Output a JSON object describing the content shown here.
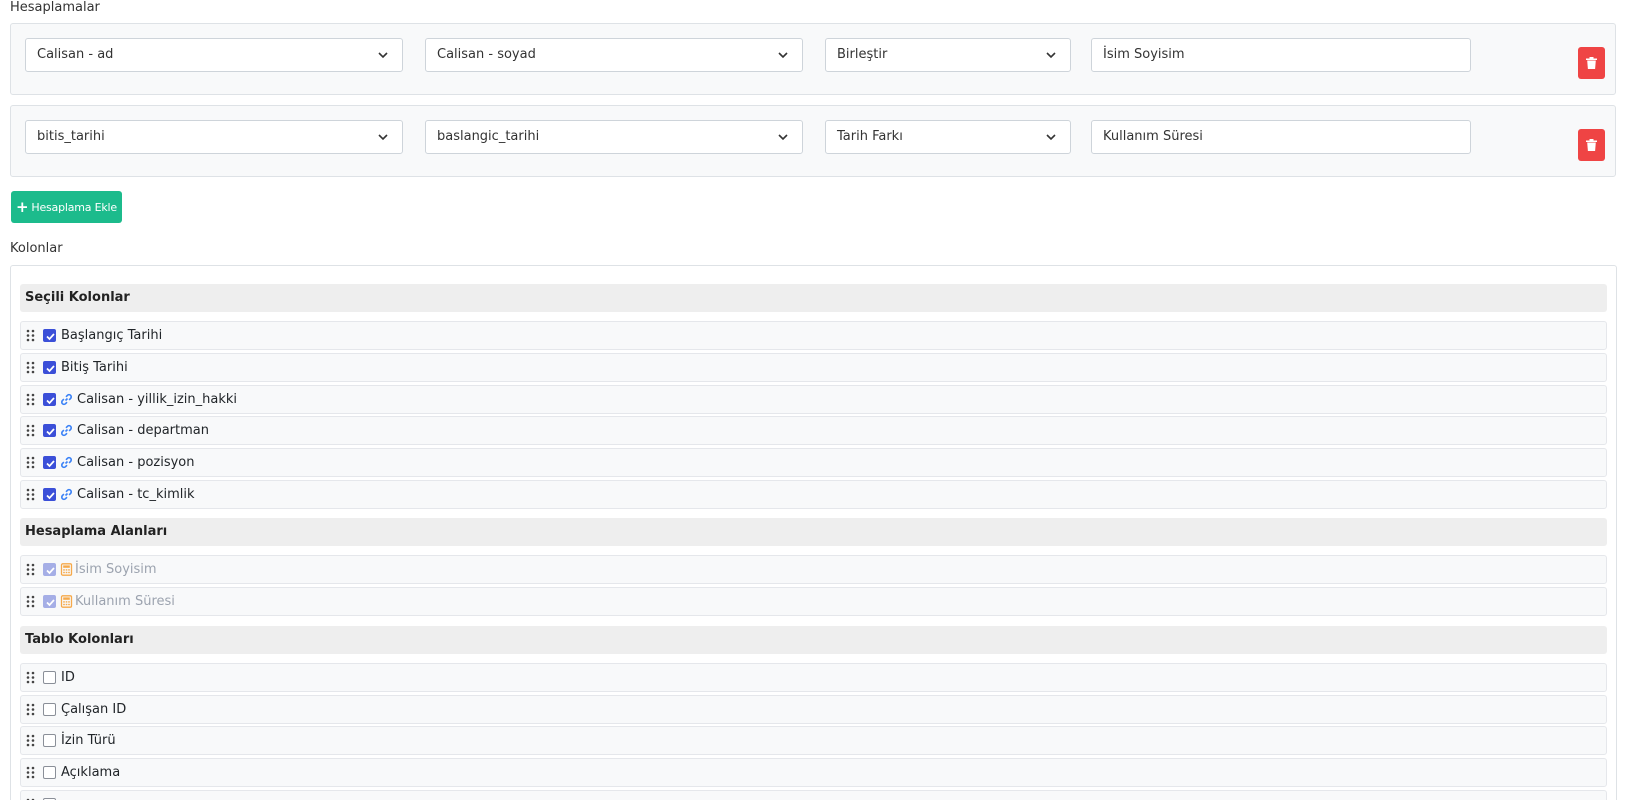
{
  "calculations": {
    "title": "Hesaplamalar",
    "rows": [
      {
        "field1": "Calisan - ad",
        "field2": "Calisan - soyad",
        "operation": "Birleştir",
        "result_name": "İsim Soyisim"
      },
      {
        "field1": "bitis_tarihi",
        "field2": "baslangic_tarihi",
        "operation": "Tarih Farkı",
        "result_name": "Kullanım Süresi"
      }
    ],
    "add_button_label": "Hesaplama Ekle"
  },
  "columns": {
    "title": "Kolonlar",
    "selected_header": "Seçili Kolonlar",
    "selected": [
      "Başlangıç Tarihi",
      "Bitiş Tarihi",
      "Calisan - yillik_izin_hakki",
      "Calisan - departman",
      "Calisan - pozisyon",
      "Calisan - tc_kimlik"
    ],
    "calc_header": "Hesaplama Alanları",
    "calc_fields": [
      "İsim Soyisim",
      "Kullanım Süresi"
    ],
    "table_header": "Tablo Kolonları",
    "table_columns": [
      "ID",
      "Çalışan ID",
      "İzin Türü",
      "Açıklama"
    ]
  },
  "icons": {
    "grip": "grip-vertical-icon",
    "link": "link-icon",
    "calculator": "calculator-icon",
    "trash": "trash-icon",
    "chevron": "chevron-down-icon",
    "plus": "plus-icon"
  },
  "colors": {
    "checkbox": "#3b4fd8",
    "delete": "#ef4444",
    "add": "#1cbb8c",
    "link": "#3b82f6",
    "calculator": "#f6a94a"
  }
}
